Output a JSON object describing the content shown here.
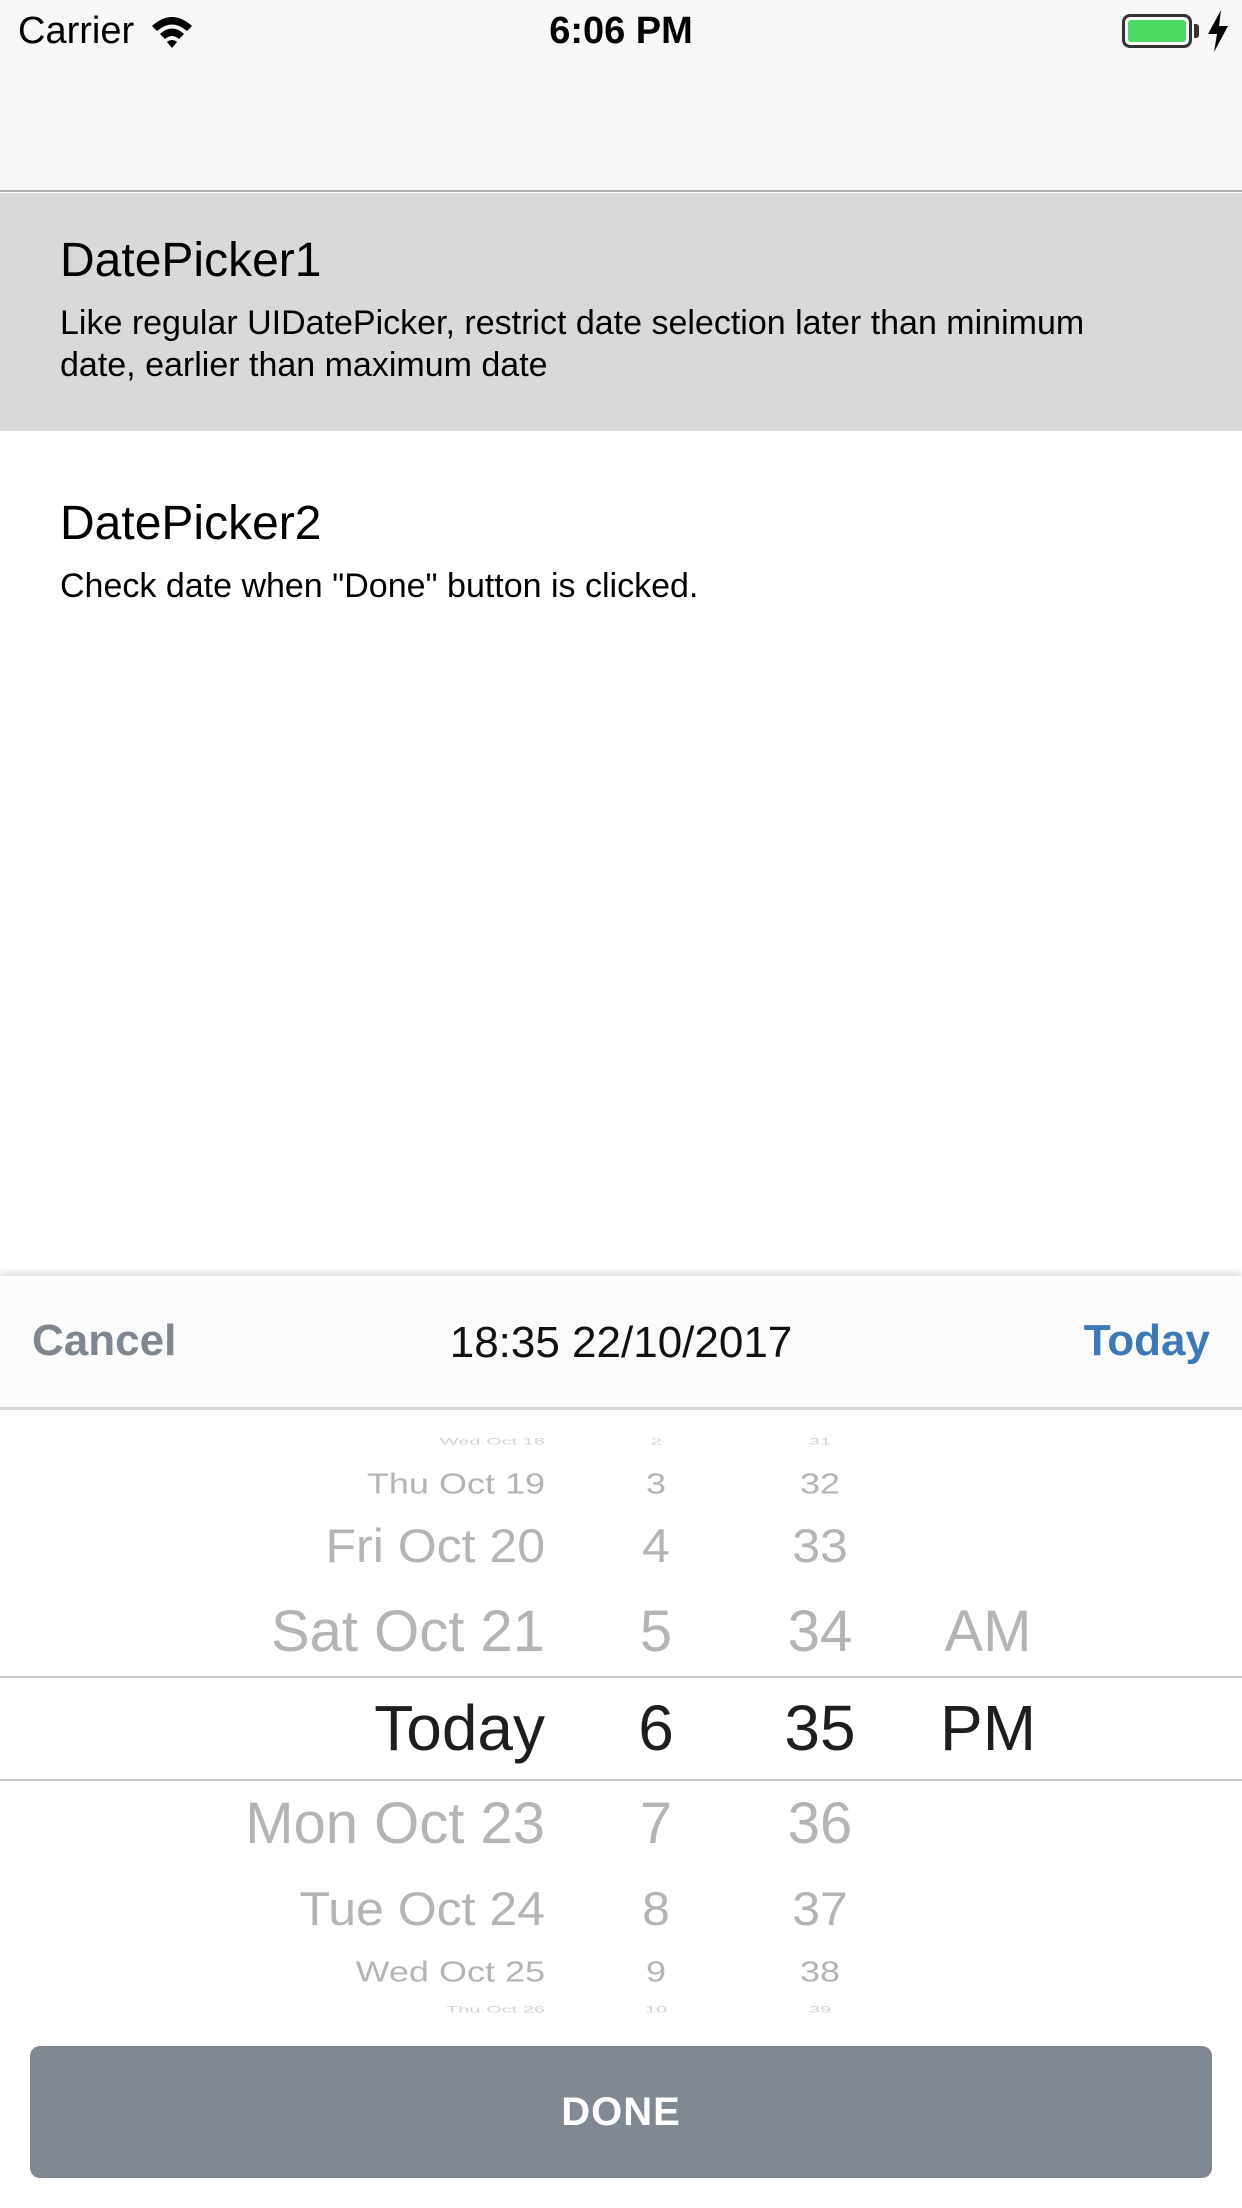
{
  "status_bar": {
    "carrier": "Carrier",
    "time": "6:06 PM",
    "wifi_icon": "wifi-icon",
    "battery_icon": "battery-icon",
    "charging_icon": "charging-bolt-icon",
    "battery_color": "#4cd964"
  },
  "list": {
    "items": [
      {
        "title": "DatePicker1",
        "subtitle": "Like regular UIDatePicker, restrict date selection later than minimum date, earlier than maximum date",
        "selected": true
      },
      {
        "title": "DatePicker2",
        "subtitle": "Check date when \"Done\" button is clicked.",
        "selected": false
      }
    ]
  },
  "picker": {
    "cancel_label": "Cancel",
    "current_value": "18:35 22/10/2017",
    "today_label": "Today",
    "done_label": "DONE",
    "accent_color": "#3d7ab5",
    "cancel_color": "#7e8790",
    "done_bg_color": "#808991",
    "days": [
      "Wed Oct 18",
      "Thu Oct 19",
      "Fri Oct 20",
      "Sat Oct 21",
      "Today",
      "Mon Oct 23",
      "Tue Oct 24",
      "Wed Oct 25",
      "Thu Oct 26"
    ],
    "hours": [
      "2",
      "3",
      "4",
      "5",
      "6",
      "7",
      "8",
      "9",
      "10"
    ],
    "minutes": [
      "31",
      "32",
      "33",
      "34",
      "35",
      "36",
      "37",
      "38",
      "39"
    ],
    "ampm": [
      "AM",
      "PM"
    ],
    "selected": {
      "day": "Today",
      "hour": "6",
      "minute": "35",
      "ampm": "PM"
    }
  }
}
